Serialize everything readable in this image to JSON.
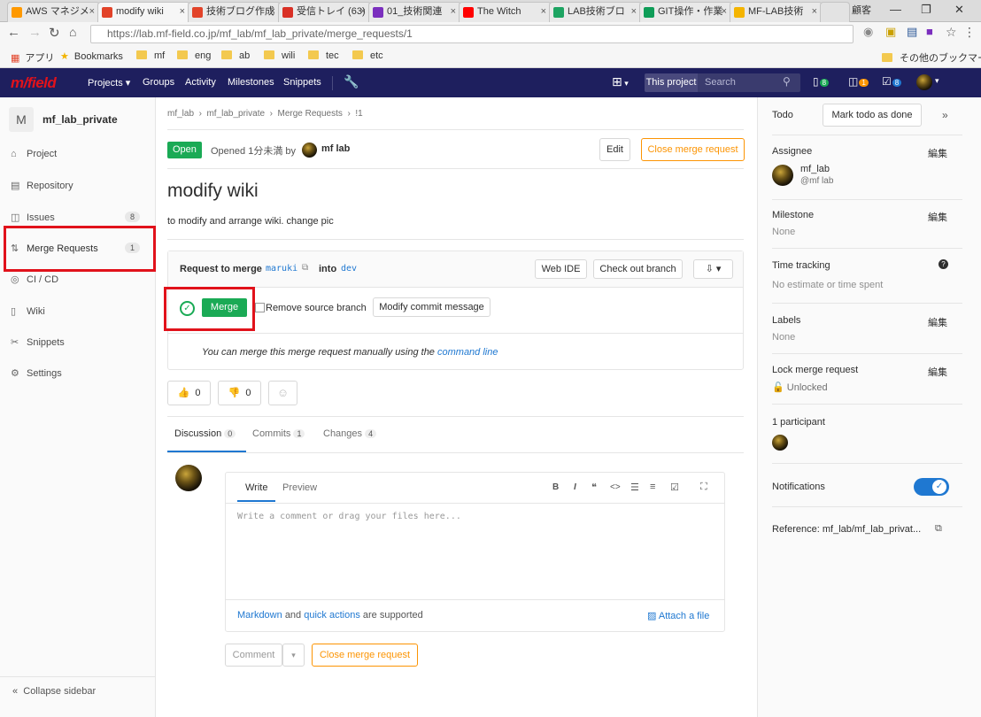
{
  "browser": {
    "tabs": [
      {
        "label": "AWS マネジメ",
        "color": "#ff9900"
      },
      {
        "label": "modify wiki",
        "color": "#e24329"
      },
      {
        "label": "技術ブログ作成",
        "color": "#e24329"
      },
      {
        "label": "受信トレイ (63)",
        "color": "#d93025"
      },
      {
        "label": "01_技術関連",
        "color": "#7b2fbe"
      },
      {
        "label": "The Witch",
        "color": "#ff0000"
      },
      {
        "label": "LAB技術ブロ",
        "color": "#1da462"
      },
      {
        "label": "GIT操作・作業",
        "color": "#0f9d58"
      },
      {
        "label": "MF-LAB技術",
        "color": "#f4b400"
      }
    ],
    "user_label": "顧客",
    "url": "https://lab.mf-field.co.jp/mf_lab/mf_lab_private/merge_requests/1",
    "bookmarks": [
      "アプリ",
      "Bookmarks",
      "mf",
      "eng",
      "ab",
      "wili",
      "tec",
      "etc"
    ],
    "other_bookmarks": "その他のブックマーク"
  },
  "header": {
    "logo": "m/field",
    "nav": [
      "Projects",
      "Groups",
      "Activity",
      "Milestones",
      "Snippets"
    ],
    "this_project": "This project",
    "search_placeholder": "Search",
    "todos": "8",
    "issues": "1",
    "mrs": "8"
  },
  "sidebar": {
    "project_letter": "M",
    "project_name": "mf_lab_private",
    "items": [
      {
        "label": "Project",
        "icon": "home-icon"
      },
      {
        "label": "Repository",
        "icon": "repository-icon"
      },
      {
        "label": "Issues",
        "icon": "issues-icon",
        "count": "8"
      },
      {
        "label": "Merge Requests",
        "icon": "merge-request-icon",
        "count": "1"
      },
      {
        "label": "CI / CD",
        "icon": "ci-icon"
      },
      {
        "label": "Wiki",
        "icon": "wiki-icon"
      },
      {
        "label": "Snippets",
        "icon": "snippets-icon"
      },
      {
        "label": "Settings",
        "icon": "settings-icon"
      }
    ],
    "collapse": "Collapse sidebar"
  },
  "main": {
    "breadcrumb": [
      "mf_lab",
      "mf_lab_private",
      "Merge Requests",
      "!1"
    ],
    "status": "Open",
    "opened_prefix": "Opened 1分未満 by",
    "author": "mf lab",
    "edit": "Edit",
    "close_mr": "Close merge request",
    "title": "modify wiki",
    "description": "to modify and arrange wiki. change pic",
    "request_to_merge": "Request to merge",
    "source_branch": "maruki",
    "into": "into",
    "target_branch": "dev",
    "web_ide": "Web IDE",
    "checkout": "Check out branch",
    "merge": "Merge",
    "remove_source": "Remove source branch",
    "modify_commit": "Modify commit message",
    "manual_merge_text": "You can merge this merge request manually using the",
    "command_line": "command line",
    "thumbs_up": "0",
    "thumbs_down": "0",
    "tabs": [
      {
        "label": "Discussion",
        "count": "0"
      },
      {
        "label": "Commits",
        "count": "1"
      },
      {
        "label": "Changes",
        "count": "4"
      }
    ],
    "write": "Write",
    "preview": "Preview",
    "comment_placeholder": "Write a comment or drag your files here...",
    "markdown": "Markdown",
    "and": "and",
    "quick_actions": "quick actions",
    "supported": "are supported",
    "attach": "Attach a file",
    "comment": "Comment",
    "close_mr_bottom": "Close merge request"
  },
  "right": {
    "todo": "Todo",
    "mark_done": "Mark todo as done",
    "assignee_label": "Assignee",
    "edit": "編集",
    "assignee_name": "mf_lab",
    "assignee_handle": "@mf lab",
    "milestone_label": "Milestone",
    "milestone_value": "None",
    "time_label": "Time tracking",
    "time_value": "No estimate or time spent",
    "labels_label": "Labels",
    "labels_value": "None",
    "lock_label": "Lock merge request",
    "lock_value": "Unlocked",
    "participants": "1 participant",
    "notifications": "Notifications",
    "reference": "Reference: mf_lab/mf_lab_privat..."
  },
  "colors": {
    "header_bg": "#1e1f5e",
    "success": "#1aaa55",
    "highlight": "#e1121b",
    "close_orange": "#fc9403",
    "toggle": "#1f78d1"
  }
}
